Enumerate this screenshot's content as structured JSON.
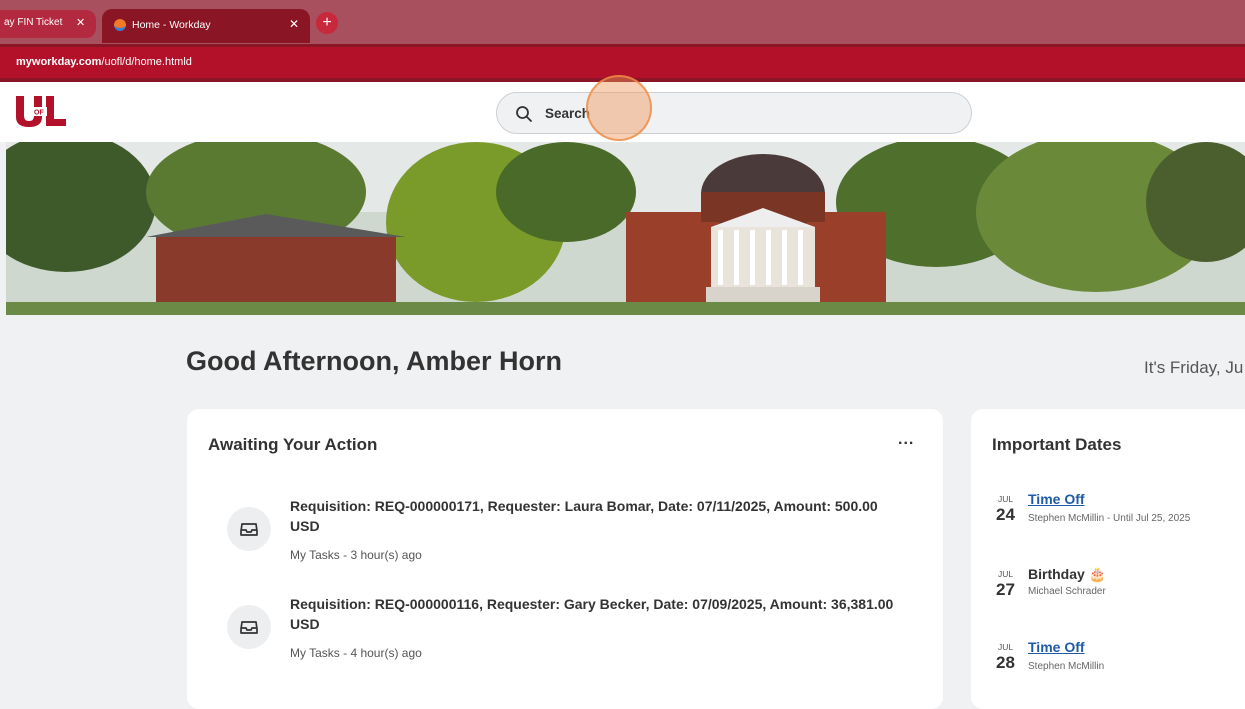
{
  "browser": {
    "tabs": [
      {
        "label": "ay FIN Ticket"
      },
      {
        "label": "Home - Workday"
      }
    ],
    "close_glyph": "✕",
    "new_tab_glyph": "+",
    "url_host": "myworkday.com",
    "url_path": "/uofl/d/home.htmld"
  },
  "header": {
    "logo_icon": "uofl-logo-icon",
    "search_placeholder": "Search"
  },
  "greeting": "Good Afternoon, Amber Horn",
  "date_text": "It's Friday, Ju",
  "awaiting": {
    "title": "Awaiting Your Action",
    "more": "...",
    "tasks": [
      {
        "text": "Requisition: REQ-000000171, Requester: Laura Bomar, Date: 07/11/2025, Amount: 500.00 USD",
        "meta": "My Tasks - 3 hour(s) ago",
        "icon": "inbox-icon"
      },
      {
        "text": "Requisition: REQ-000000116, Requester: Gary Becker, Date: 07/09/2025, Amount: 36,381.00 USD",
        "meta": "My Tasks - 4 hour(s) ago",
        "icon": "inbox-icon"
      }
    ]
  },
  "important_dates": {
    "title": "Important Dates",
    "events": [
      {
        "month": "JUL",
        "day": "24",
        "title": "Time Off",
        "sub": "Stephen McMillin - Until Jul 25, 2025",
        "link": true
      },
      {
        "month": "JUL",
        "day": "27",
        "title": "Birthday 🎂",
        "sub": "Michael Schrader",
        "link": false
      },
      {
        "month": "JUL",
        "day": "28",
        "title": "Time Off",
        "sub": "Stephen McMillin",
        "link": true
      }
    ]
  },
  "colors": {
    "brand_red": "#b3102a",
    "link_blue": "#1f5aa6"
  }
}
